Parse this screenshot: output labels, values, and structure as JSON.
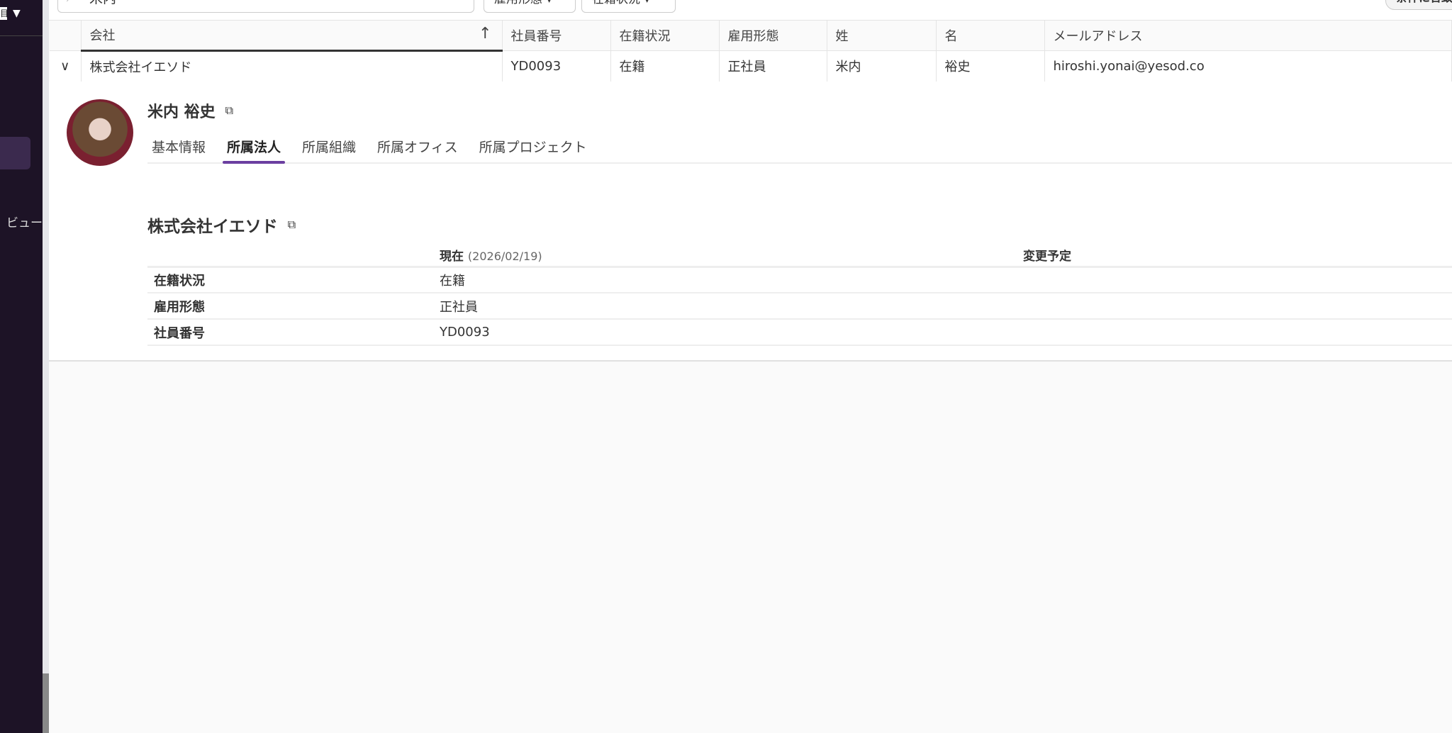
{
  "sidebar": {
    "top_label": "目",
    "view_label": "ビュー"
  },
  "filters": {
    "search_value": "米内",
    "dropdowns": [
      "雇用形態",
      "在籍状況"
    ],
    "right_button": "条件に合致"
  },
  "table": {
    "columns": [
      "会社",
      "社員番号",
      "在籍状況",
      "雇用形態",
      "姓",
      "名",
      "メールアドレス"
    ],
    "rows": [
      {
        "company": "株式会社イエソド",
        "employee_no": "YD0093",
        "status": "在籍",
        "employment": "正社員",
        "last": "米内",
        "first": "裕史",
        "email": "hiroshi.yonai@yesod.co"
      }
    ]
  },
  "detail": {
    "name": "米内 裕史",
    "tabs": [
      "基本情報",
      "所属法人",
      "所属組織",
      "所属オフィス",
      "所属プロジェクト"
    ],
    "active_tab": "所属法人",
    "company": "株式会社イエソド",
    "current_label": "現在",
    "current_date": "(2026/02/19)",
    "planned_label": "変更予定",
    "rows": [
      {
        "label": "在籍状況",
        "current": "在籍"
      },
      {
        "label": "雇用形態",
        "current": "正社員"
      },
      {
        "label": "社員番号",
        "current": "YD0093"
      }
    ]
  },
  "colors": {
    "sidebar": "#1d1326",
    "accent": "#6b3fa0"
  }
}
